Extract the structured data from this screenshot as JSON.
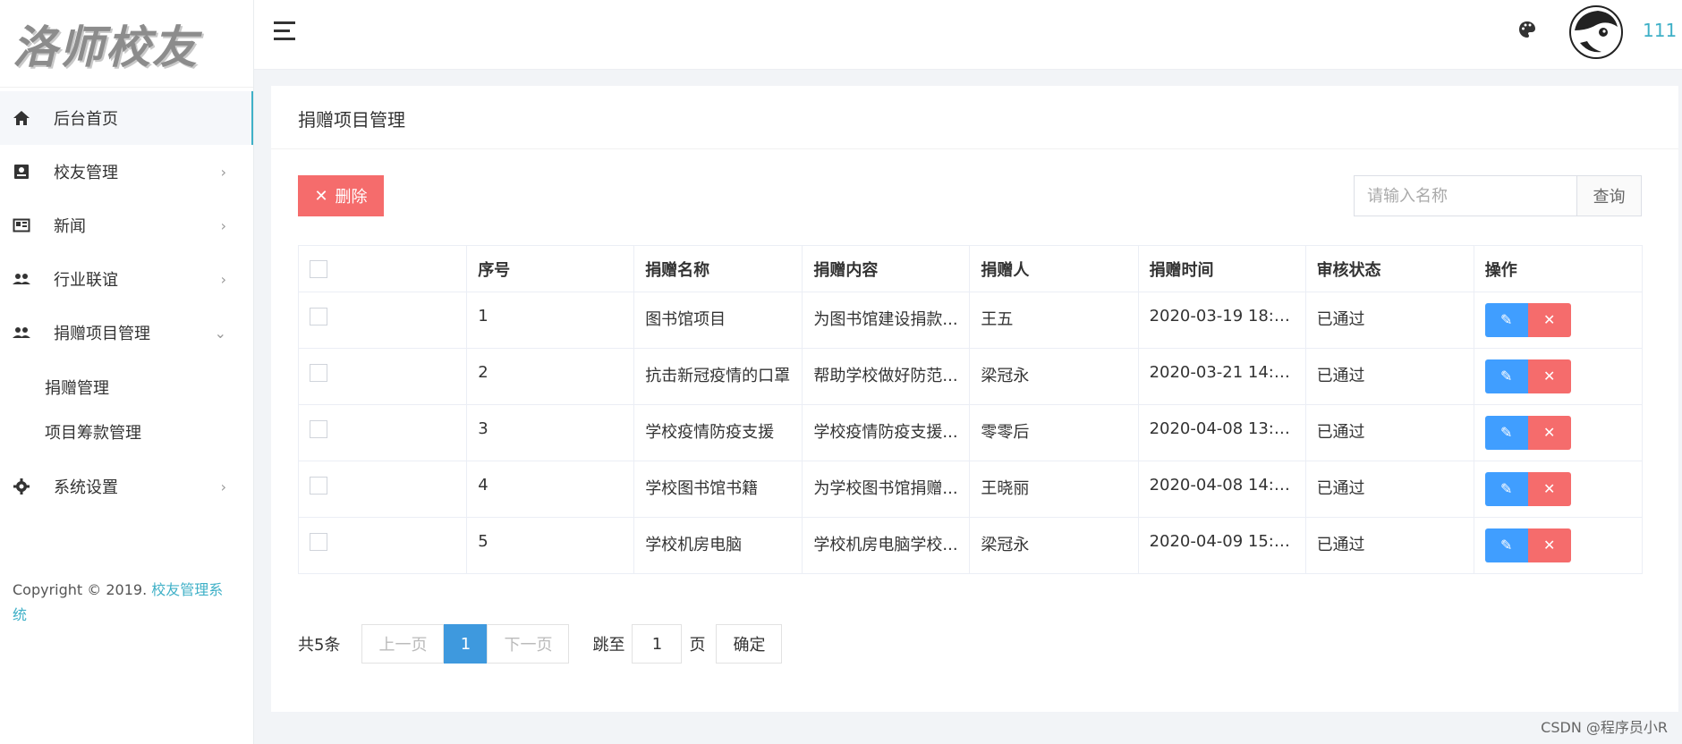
{
  "brand": {
    "logo_text": "洛师校友"
  },
  "sidebar": {
    "items": [
      {
        "label": "后台首页",
        "icon": "home-icon",
        "has_children": false
      },
      {
        "label": "校友管理",
        "icon": "contact-card-icon",
        "has_children": true
      },
      {
        "label": "新闻",
        "icon": "newspaper-icon",
        "has_children": true
      },
      {
        "label": "行业联谊",
        "icon": "people-icon",
        "has_children": true
      },
      {
        "label": "捐赠项目管理",
        "icon": "people-icon",
        "has_children": true,
        "expanded": true,
        "children": [
          {
            "label": "捐赠管理"
          },
          {
            "label": "项目筹款管理"
          }
        ]
      },
      {
        "label": "系统设置",
        "icon": "gear-icon",
        "has_children": true
      }
    ],
    "copyright_prefix": "Copyright © 2019. ",
    "copyright_link": "校友管理系统"
  },
  "header": {
    "username": "111"
  },
  "main": {
    "title": "捐赠项目管理",
    "delete_button": "删除",
    "search": {
      "placeholder": "请输入名称",
      "button": "查询"
    },
    "table": {
      "columns": [
        "序号",
        "捐赠名称",
        "捐赠内容",
        "捐赠人",
        "捐赠时间",
        "审核状态",
        "操作"
      ],
      "rows": [
        {
          "index": "1",
          "name": "图书馆项目",
          "content": "为图书馆建设捐款...",
          "donor": "王五",
          "time": "2020-03-19 18:0...",
          "status": "已通过"
        },
        {
          "index": "2",
          "name": "抗击新冠疫情的口罩",
          "content": "帮助学校做好防范...",
          "donor": "梁冠永",
          "time": "2020-03-21 14:2...",
          "status": "已通过"
        },
        {
          "index": "3",
          "name": "学校疫情防疫支援",
          "content": "学校疫情防疫支援...",
          "donor": "零零后",
          "time": "2020-04-08 13:3...",
          "status": "已通过"
        },
        {
          "index": "4",
          "name": "学校图书馆书籍",
          "content": "为学校图书馆捐赠...",
          "donor": "王晓丽",
          "time": "2020-04-08 14:1...",
          "status": "已通过"
        },
        {
          "index": "5",
          "name": "学校机房电脑",
          "content": "学校机房电脑学校...",
          "donor": "梁冠永",
          "time": "2020-04-09 15:0...",
          "status": "已通过"
        }
      ]
    },
    "pagination": {
      "total": "共5条",
      "prev": "上一页",
      "current": "1",
      "next": "下一页",
      "jump_label": "跳至",
      "jump_value": "1",
      "jump_unit": "页",
      "confirm": "确定"
    }
  },
  "watermark": "CSDN @程序员小R",
  "colors": {
    "accent": "#3fb0c7",
    "danger": "#f56c6c",
    "primary": "#409eff",
    "page_active": "#3e99de"
  }
}
